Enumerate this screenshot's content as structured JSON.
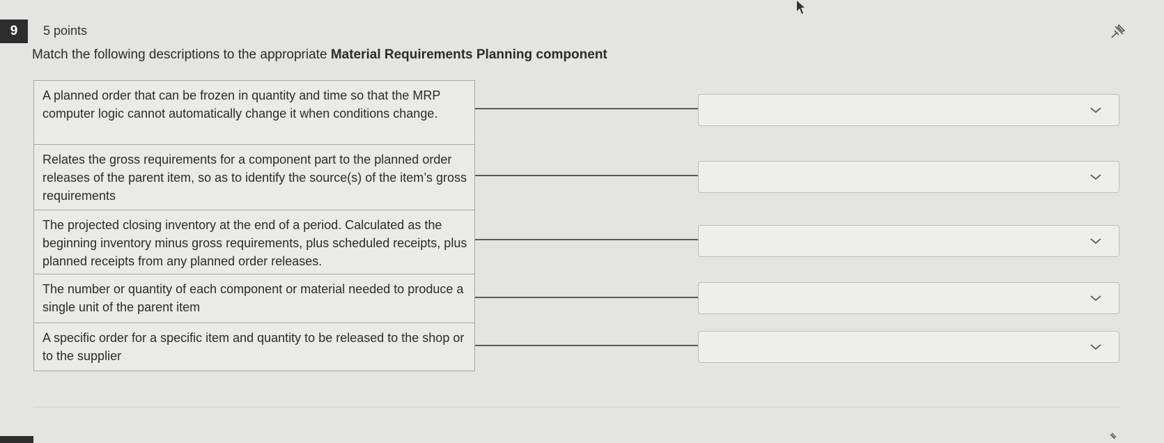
{
  "question": {
    "number": "9",
    "points": "5 points",
    "prompt_prefix": "Match the following descriptions to the appropriate ",
    "prompt_bold": "Material Requirements Planning component"
  },
  "items": [
    {
      "description": "A planned order that can be frozen in quantity and time so that the MRP computer logic cannot automatically change it when conditions change.",
      "selected": ""
    },
    {
      "description": "Relates the gross requirements for a component part to the planned order releases of the parent item, so as to identify the source(s) of the item’s gross requirements",
      "selected": ""
    },
    {
      "description": "The projected closing inventory at the end of a period. Calculated as the beginning inventory minus gross requirements, plus scheduled receipts, plus planned receipts from any planned order releases.",
      "selected": ""
    },
    {
      "description": "The number or quantity of each component or material needed to produce a single unit of the parent item",
      "selected": ""
    },
    {
      "description": "A specific order for a specific item and quantity to be released to the shop or to the supplier",
      "selected": ""
    }
  ],
  "icons": {
    "pin": "pin-icon",
    "dropdown": "chevron-down-icon"
  }
}
